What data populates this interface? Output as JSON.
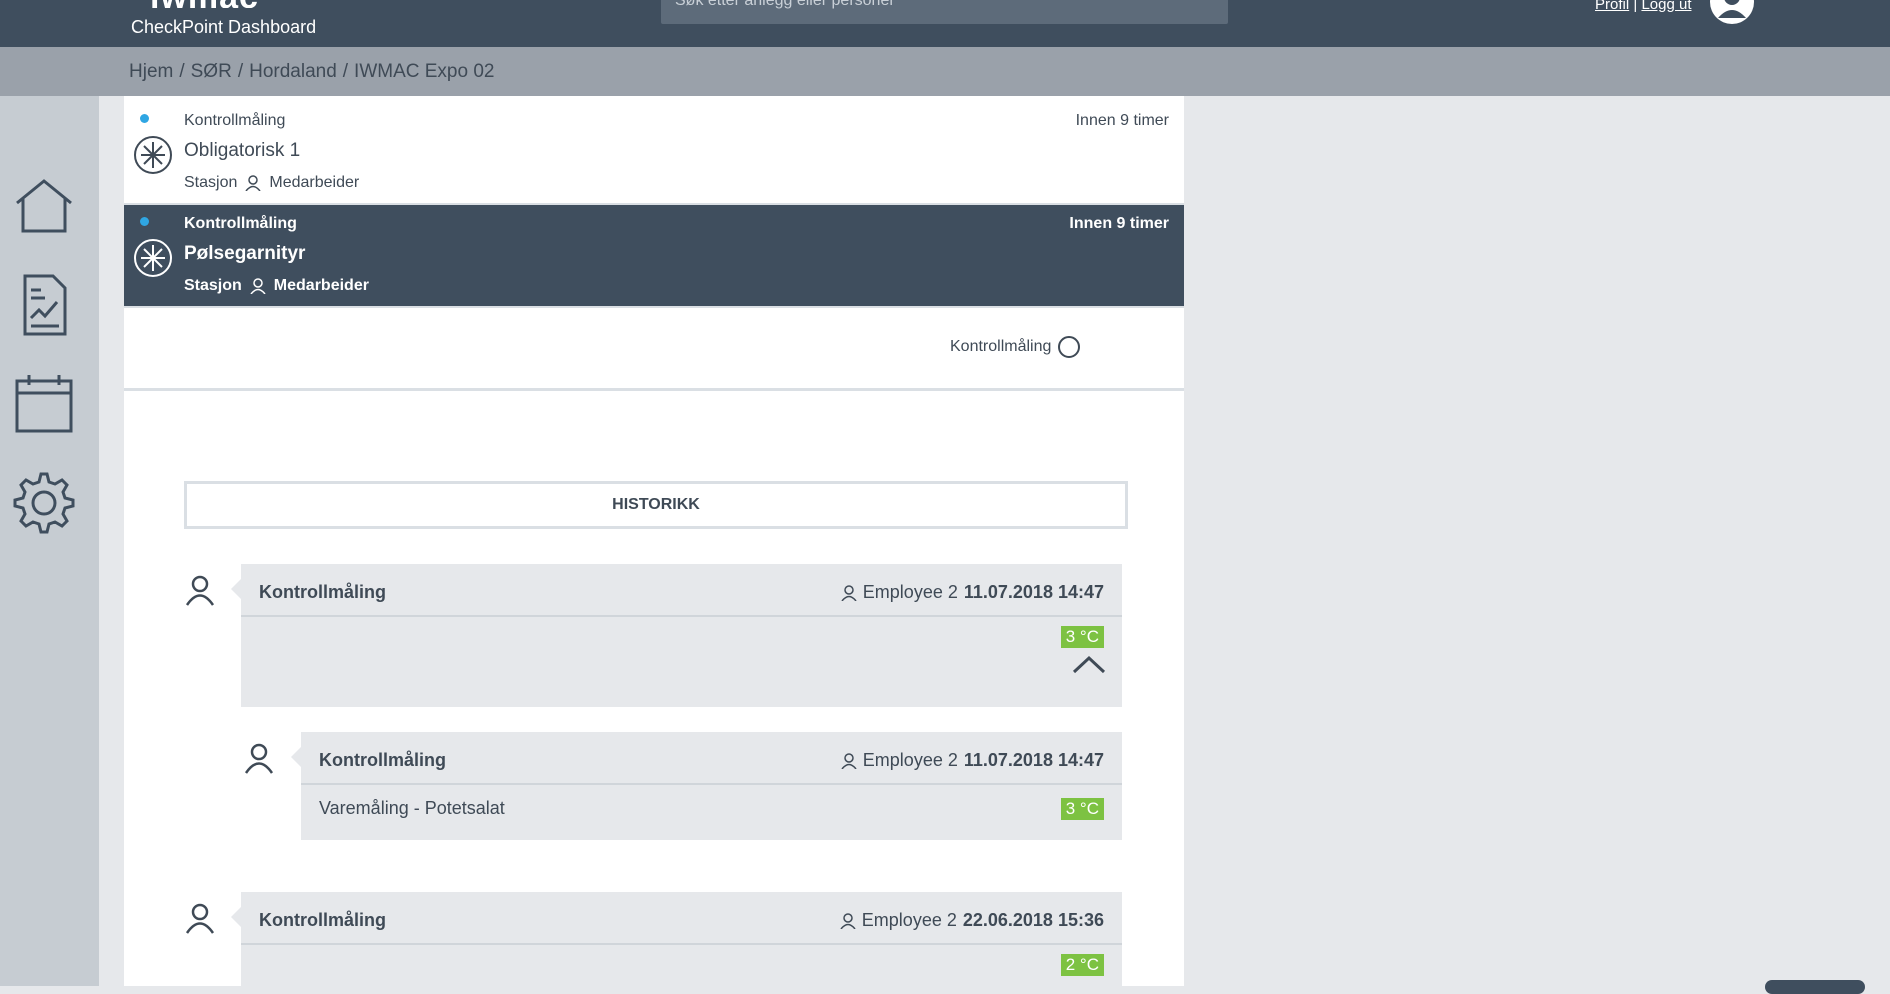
{
  "header": {
    "logo_text": "iwmac",
    "app_title": "CheckPoint Dashboard",
    "search_placeholder": "Søk etter anlegg eller personer",
    "profile_link": "Profil",
    "divider": "|",
    "logout_link": "Logg ut"
  },
  "breadcrumb": [
    "Hjem",
    "SØR",
    "Hordaland",
    "IWMAC Expo 02"
  ],
  "breadcrumb_sep": "/",
  "sidebar": {
    "items": [
      {
        "icon": "home-icon"
      },
      {
        "icon": "report-icon"
      },
      {
        "icon": "calendar-icon"
      },
      {
        "icon": "settings-icon"
      }
    ]
  },
  "tasks": [
    {
      "category": "Kontrollmåling",
      "due": "Innen 9 timer",
      "title": "Obligatorisk 1",
      "station": "Stasjon",
      "role": "Medarbeider",
      "selected": false
    },
    {
      "category": "Kontrollmåling",
      "due": "Innen 9 timer",
      "title": "Pølsegarnityr",
      "station": "Stasjon",
      "role": "Medarbeider",
      "selected": true
    }
  ],
  "filter": {
    "label": "Kontrollmåling"
  },
  "history": {
    "button_label": "HISTORIKK",
    "entries": [
      {
        "title": "Kontrollmåling",
        "user": "Employee 2",
        "datetime": "11.07.2018 14:47",
        "value": "3 °C",
        "body": "",
        "expanded": true
      },
      {
        "title": "Kontrollmåling",
        "user": "Employee 2",
        "datetime": "11.07.2018 14:47",
        "value": "3 °C",
        "body": "Varemåling - Potetsalat",
        "nested": true
      },
      {
        "title": "Kontrollmåling",
        "user": "Employee 2",
        "datetime": "22.06.2018 15:36",
        "value": "2 °C",
        "body": ""
      }
    ]
  },
  "colors": {
    "header_bg": "#3f4e5e",
    "accent_dot": "#2fa6e3",
    "badge_ok": "#7dc242"
  }
}
